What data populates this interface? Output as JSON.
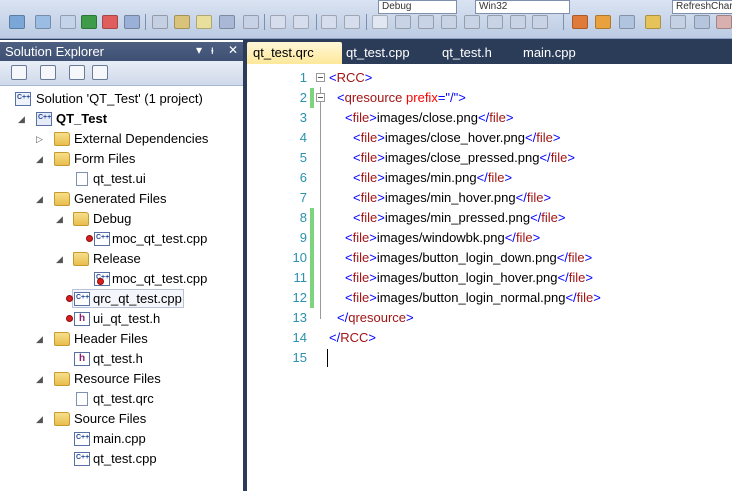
{
  "toolbar": {
    "config_combo": "Debug",
    "platform_combo": "Win32",
    "find_combo": "RefreshChart"
  },
  "solution_explorer": {
    "title": "Solution Explorer",
    "pin_glyph": "▼ ᵻ ✕",
    "tree": [
      {
        "label": "Solution 'QT_Test' (1 project)",
        "icon": "solution-icon"
      },
      {
        "label": "QT_Test",
        "icon": "project-icon",
        "bold": true
      },
      {
        "label": "External Dependencies",
        "icon": "folder-icon"
      },
      {
        "label": "Form Files",
        "icon": "folder-icon"
      },
      {
        "label": "qt_test.ui",
        "icon": "file-icon"
      },
      {
        "label": "Generated Files",
        "icon": "folder-icon"
      },
      {
        "label": "Debug",
        "icon": "folder-icon"
      },
      {
        "label": "moc_qt_test.cpp",
        "icon": "cpp-file-icon"
      },
      {
        "label": "Release",
        "icon": "folder-icon"
      },
      {
        "label": "moc_qt_test.cpp",
        "icon": "cpp-file-icon"
      },
      {
        "label": "qrc_qt_test.cpp",
        "icon": "cpp-file-icon"
      },
      {
        "label": "ui_qt_test.h",
        "icon": "header-file-icon"
      },
      {
        "label": "Header Files",
        "icon": "folder-icon"
      },
      {
        "label": "qt_test.h",
        "icon": "header-file-icon"
      },
      {
        "label": "Resource Files",
        "icon": "folder-icon"
      },
      {
        "label": "qt_test.qrc",
        "icon": "file-icon"
      },
      {
        "label": "Source Files",
        "icon": "folder-icon"
      },
      {
        "label": "main.cpp",
        "icon": "cpp-file-icon"
      },
      {
        "label": "qt_test.cpp",
        "icon": "cpp-file-icon"
      }
    ]
  },
  "tabs": [
    {
      "label": "qt_test.qrc",
      "active": true
    },
    {
      "label": "qt_test.cpp",
      "active": false
    },
    {
      "label": "qt_test.h",
      "active": false
    },
    {
      "label": "main.cpp",
      "active": false
    }
  ],
  "editor": {
    "lines": [
      {
        "n": "1",
        "text": "<RCC>"
      },
      {
        "n": "2",
        "text": "<qresource prefix=\"/\">"
      },
      {
        "n": "3",
        "text": "<file>images/close.png</file>"
      },
      {
        "n": "4",
        "text": "<file>images/close_hover.png</file>"
      },
      {
        "n": "5",
        "text": "<file>images/close_pressed.png</file>"
      },
      {
        "n": "6",
        "text": "<file>images/min.png</file>"
      },
      {
        "n": "7",
        "text": "<file>images/min_hover.png</file>"
      },
      {
        "n": "8",
        "text": "<file>images/min_pressed.png</file>"
      },
      {
        "n": "9",
        "text": "<file>images/windowbk.png</file>"
      },
      {
        "n": "10",
        "text": "<file>images/button_login_down.png</file>"
      },
      {
        "n": "11",
        "text": "<file>images/button_login_hover.png</file>"
      },
      {
        "n": "12",
        "text": "<file>images/button_login_normal.png</file>"
      },
      {
        "n": "13",
        "text": "</qresource>"
      },
      {
        "n": "14",
        "text": "</RCC>"
      },
      {
        "n": "15",
        "text": ""
      }
    ]
  }
}
